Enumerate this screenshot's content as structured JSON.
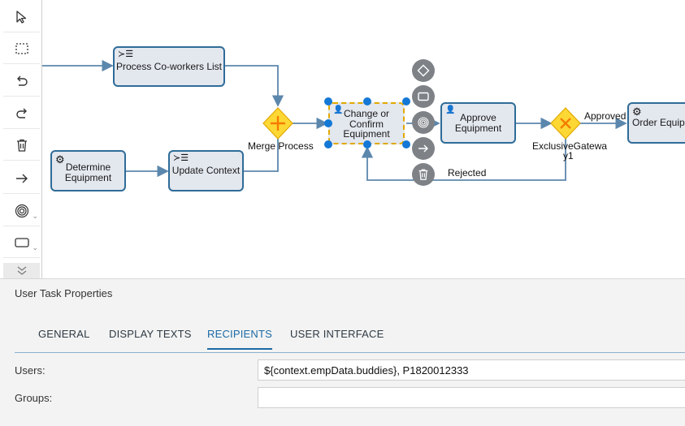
{
  "toolbar": {
    "tools": [
      {
        "name": "select-pointer-icon"
      },
      {
        "name": "marquee-select-icon"
      },
      {
        "name": "undo-icon"
      },
      {
        "name": "redo-icon"
      },
      {
        "name": "delete-icon"
      },
      {
        "name": "connector-arrow-icon"
      },
      {
        "name": "event-icon"
      },
      {
        "name": "task-icon"
      },
      {
        "name": "expand-more-icon"
      }
    ]
  },
  "diagram": {
    "nodes": {
      "process_coworkers": "Process Co-workers List",
      "determine_equipment": "Determine Equipment",
      "update_context": "Update Context",
      "change_confirm": "Change or Confirm Equipment",
      "approve_equipment": "Approve Equipment",
      "order_equipment": "Order Equipme"
    },
    "gateways": {
      "merge": "Merge Process",
      "exclusive_line1": "ExclusiveGatewa",
      "exclusive_line2": "y1"
    },
    "flows": {
      "approved": "Approved",
      "rejected": "Rejected"
    },
    "colors": {
      "task_fill": "#e3e7ee",
      "task_border": "#2f6c98",
      "connector": "#5c87ad",
      "gateway_fill": "#fdd835",
      "selection": "#1478d6"
    }
  },
  "panel": {
    "title": "User Task Properties",
    "tabs": [
      "GENERAL",
      "DISPLAY TEXTS",
      "RECIPIENTS",
      "USER INTERFACE"
    ],
    "active_tab": "RECIPIENTS",
    "fields": {
      "users_label": "Users:",
      "users_value": "${context.empData.buddies}, P1820012333",
      "groups_label": "Groups:",
      "groups_value": ""
    }
  }
}
